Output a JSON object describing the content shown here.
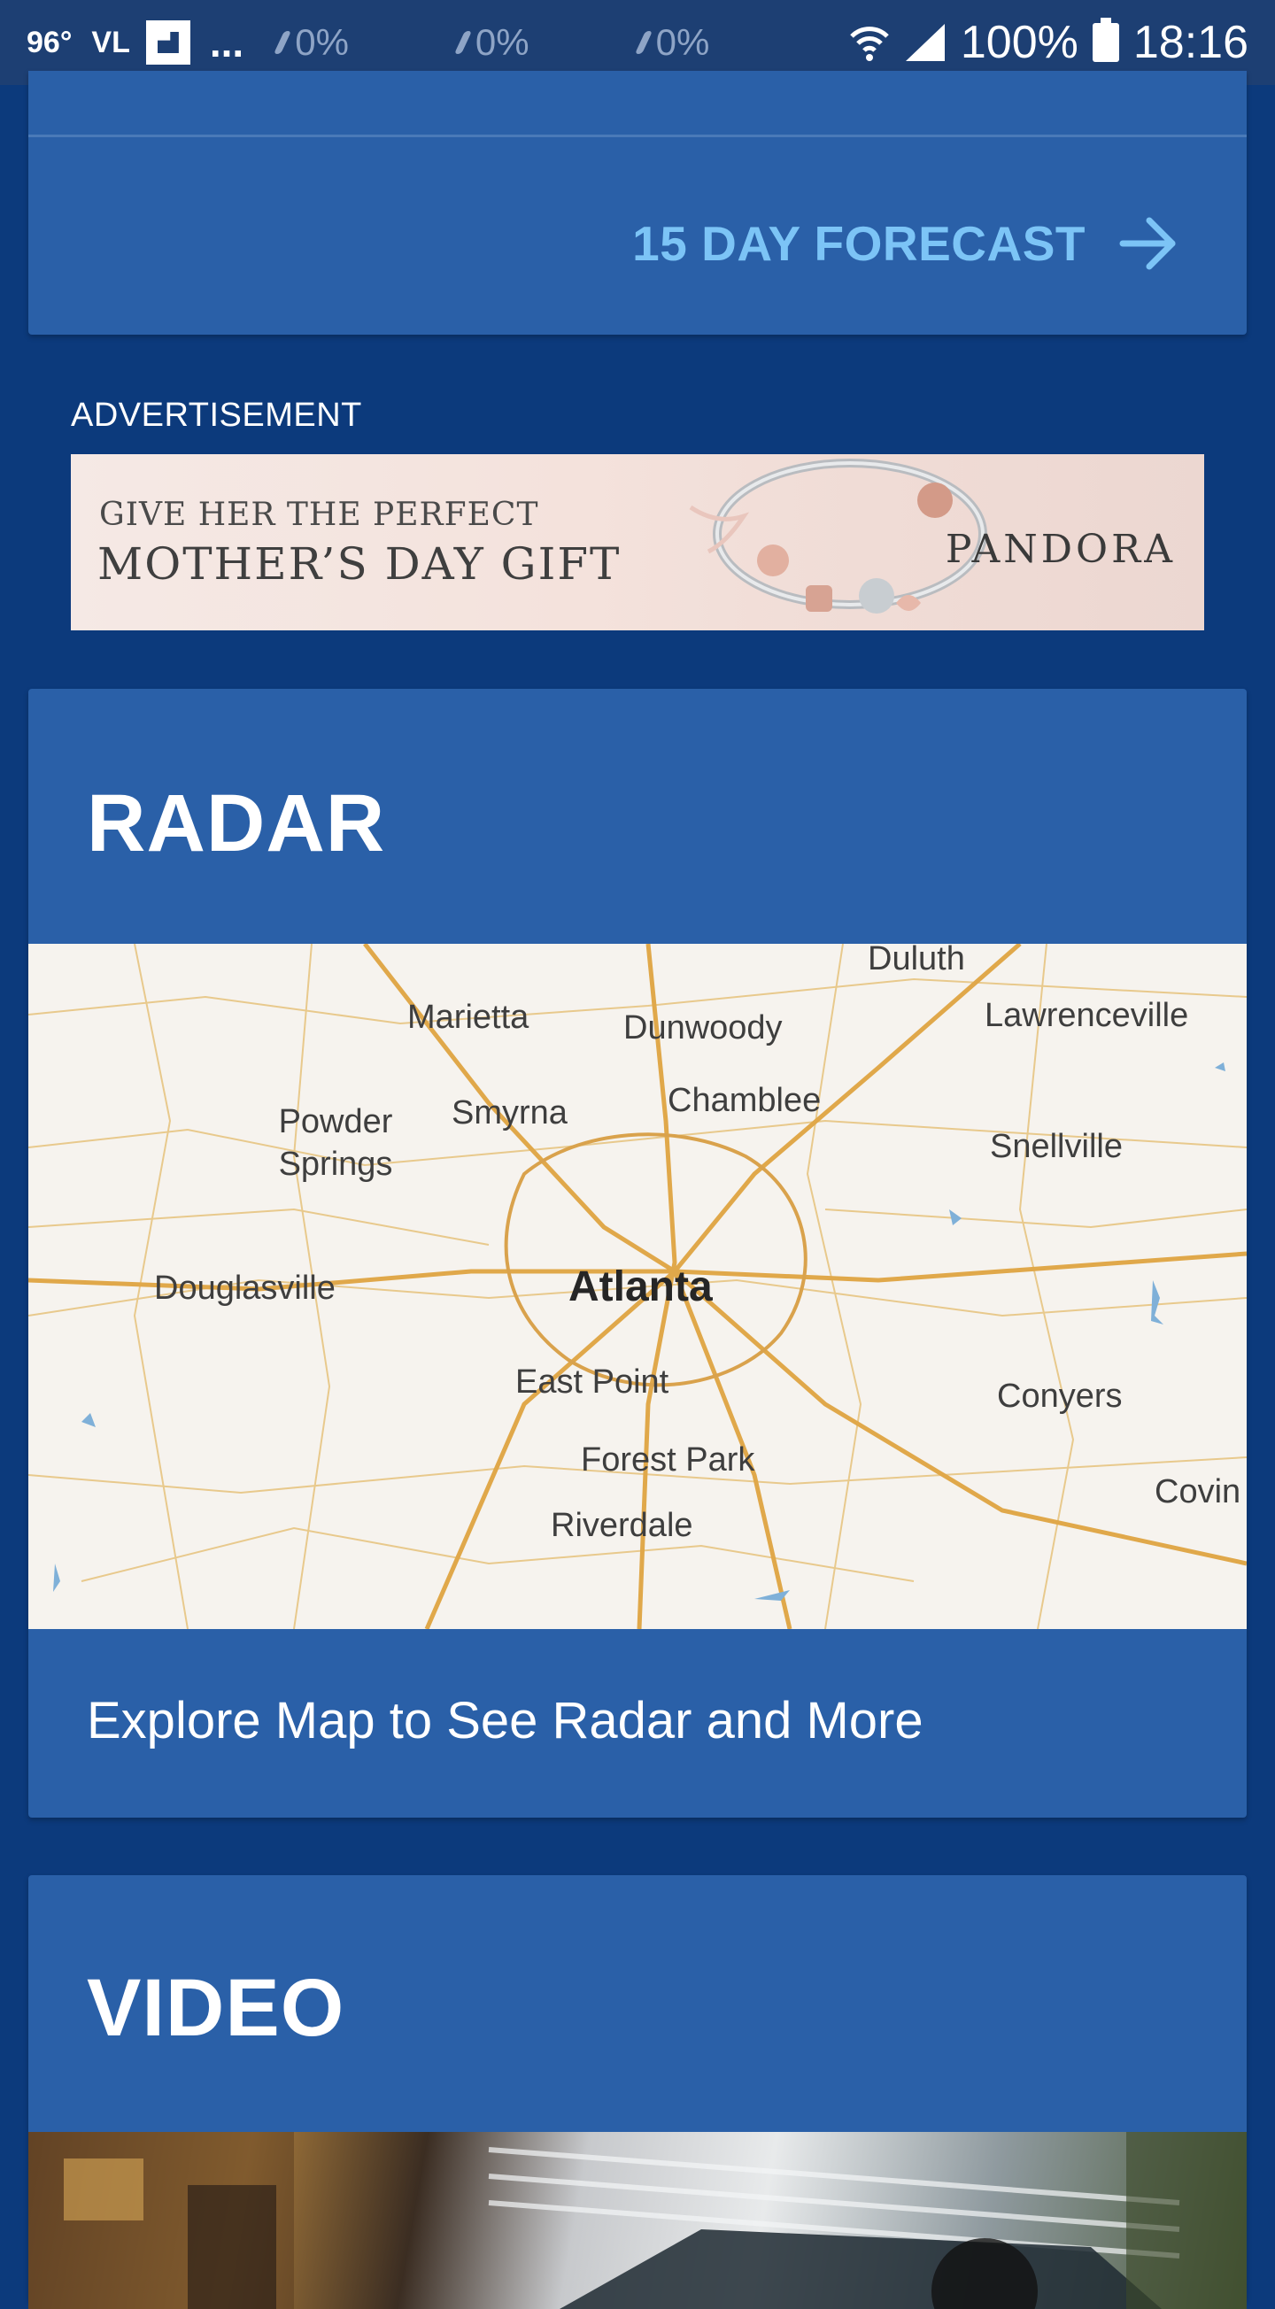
{
  "status_bar": {
    "temperature": "96°",
    "carrier": "VL",
    "dots": "...",
    "ghost_precip": [
      "0%",
      "0%",
      "0%"
    ],
    "battery": "100%",
    "time": "18:16"
  },
  "forecast": {
    "link_label": "15 DAY FORECAST"
  },
  "advertisement": {
    "label": "ADVERTISEMENT",
    "line1": "GIVE HER THE PERFECT",
    "line2": "MOTHER’S DAY GIFT",
    "brand": "PANDORA"
  },
  "radar": {
    "title": "RADAR",
    "caption": "Explore Map to See Radar and More",
    "map_labels": [
      "Duluth",
      "Marietta",
      "Dunwoody",
      "Lawrenceville",
      "Chamblee",
      "Powder Springs",
      "Smyrna",
      "Snellville",
      "Douglasville",
      "Atlanta",
      "East Point",
      "Conyers",
      "Forest Park",
      "Covin",
      "Riverdale"
    ]
  },
  "video": {
    "title": "VIDEO"
  },
  "colors": {
    "background": "#0c3a7c",
    "card": "#2a60a8",
    "link": "#7cc4f6",
    "status_bar": "#1d3f73"
  }
}
